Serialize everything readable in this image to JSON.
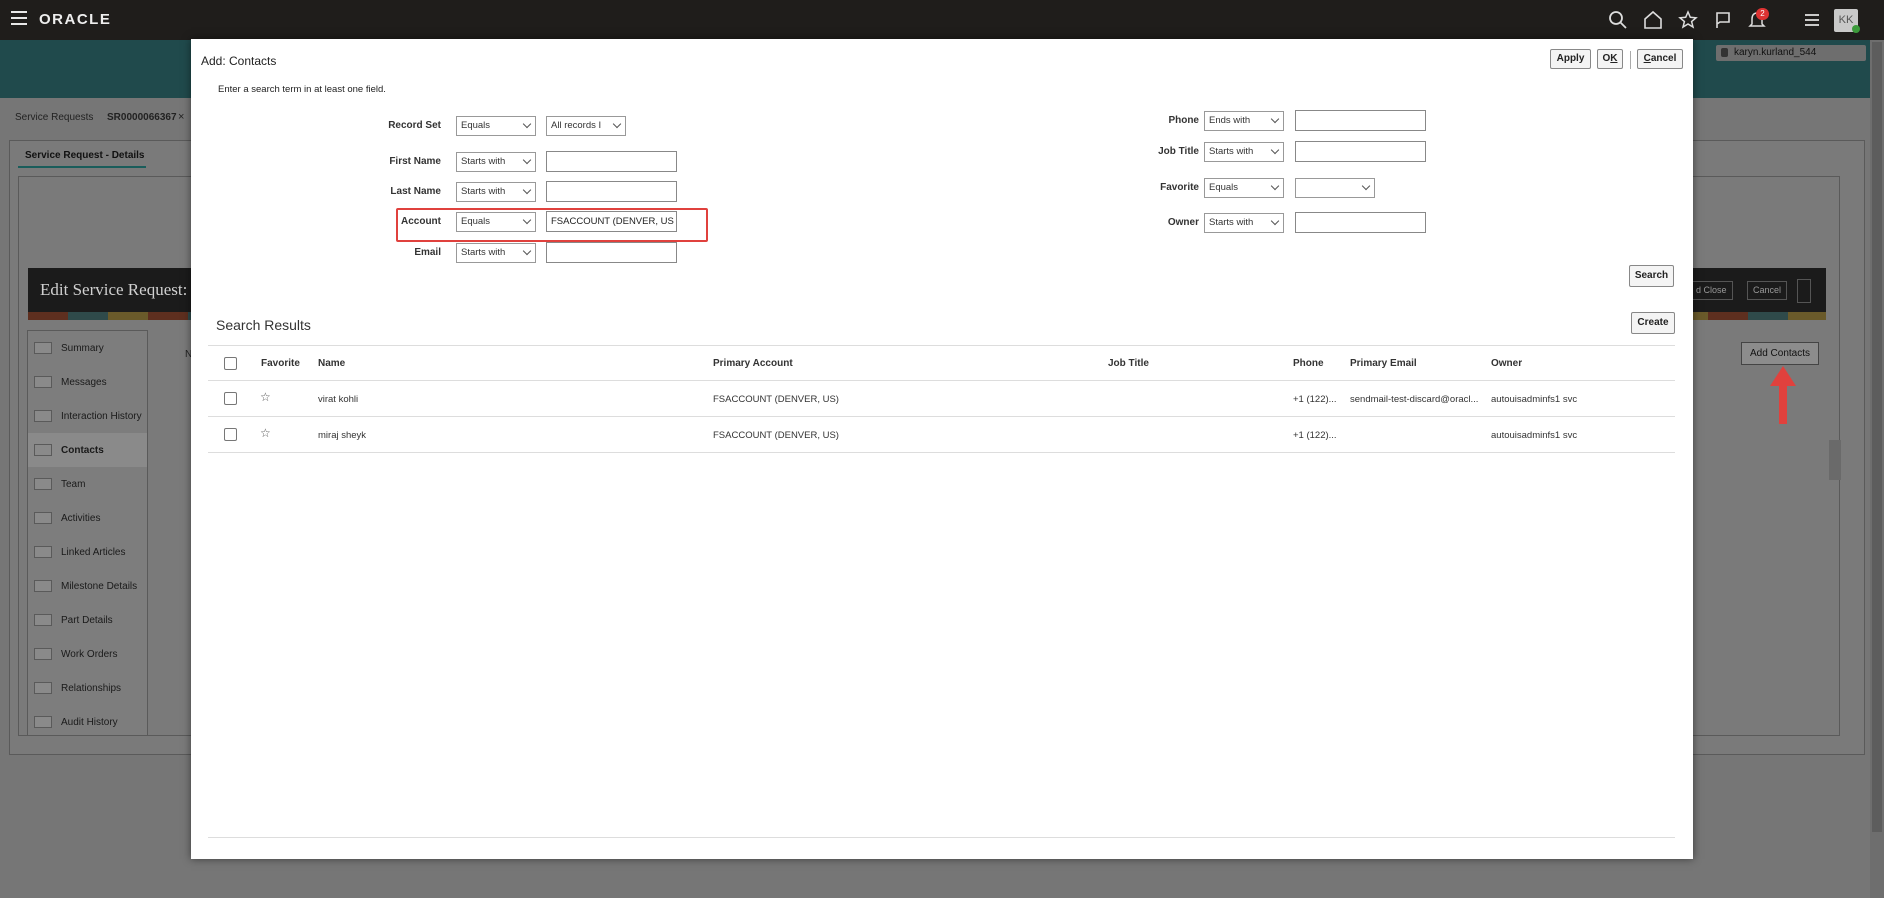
{
  "topbar": {
    "logo": "ORACLE",
    "notification_count": "2",
    "avatar_initials": "KK"
  },
  "background": {
    "tabs": [
      "Service Requests",
      "SR0000066367"
    ],
    "tab_close": "×",
    "subtab": "Service Request - Details",
    "edit_title": "Edit Service Request:",
    "user": "karyn.kurland_544",
    "cut_label": "N",
    "buttons": {
      "save_close": "d Close",
      "cancel": "Cancel",
      "add_contacts": "Add Contacts"
    },
    "sidebar": [
      "Summary",
      "Messages",
      "Interaction History",
      "Contacts",
      "Team",
      "Activities",
      "Linked Articles",
      "Milestone Details",
      "Part Details",
      "Work Orders",
      "Relationships",
      "Audit History"
    ],
    "sidebar_active": "Contacts"
  },
  "modal": {
    "title": "Add: Contacts",
    "hint": "Enter a search term in at least one field.",
    "buttons": {
      "apply": "Apply",
      "ok_pre": "O",
      "ok_u": "K",
      "cancel_pre": "",
      "cancel_u": "C",
      "cancel_post": "ancel",
      "search": "Search",
      "create": "Create"
    },
    "left_fields": [
      {
        "label": "Record Set",
        "operator": "Equals",
        "value": "All records I"
      },
      {
        "label": "First Name",
        "operator": "Starts with",
        "value": ""
      },
      {
        "label": "Last Name",
        "operator": "Starts with",
        "value": ""
      },
      {
        "label": "Account",
        "operator": "Equals",
        "value": "FSACCOUNT (DENVER, US"
      },
      {
        "label": "Email",
        "operator": "Starts with",
        "value": ""
      }
    ],
    "right_fields": [
      {
        "label": "Phone",
        "operator": "Ends with",
        "value": ""
      },
      {
        "label": "Job Title",
        "operator": "Starts with",
        "value": ""
      },
      {
        "label": "Favorite",
        "operator": "Equals",
        "value": ""
      },
      {
        "label": "Owner",
        "operator": "Starts with",
        "value": ""
      }
    ],
    "results_title": "Search Results",
    "columns": [
      "Favorite",
      "Name",
      "Primary Account",
      "Job Title",
      "Phone",
      "Primary Email",
      "Owner"
    ],
    "rows": [
      {
        "favorite": "☆",
        "name": "virat kohli",
        "account": "FSACCOUNT (DENVER, US)",
        "job_title": "",
        "phone": "+1 (122)...",
        "email": "sendmail-test-discard@oracl...",
        "owner": "autouisadminfs1 svc"
      },
      {
        "favorite": "☆",
        "name": "miraj sheyk",
        "account": "FSACCOUNT (DENVER, US)",
        "job_title": "",
        "phone": "+1 (122)...",
        "email": "",
        "owner": "autouisadminfs1 svc"
      }
    ]
  },
  "colors": {
    "topbar": "#1f1d1b",
    "highlight": "#e0413d",
    "band": "#204a4c"
  }
}
